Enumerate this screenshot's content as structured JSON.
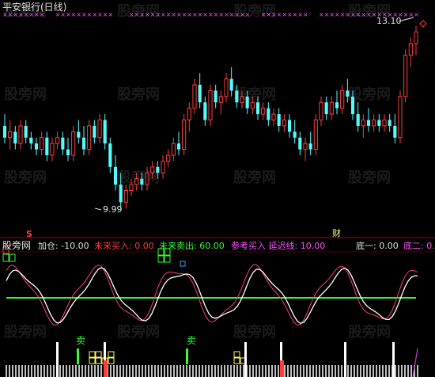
{
  "upper_panel": {
    "title": "平安银行(日线)",
    "high_label": "13.10",
    "low_label": "9.99",
    "marker_s": "S",
    "marker_cai": "财"
  },
  "indicator_header": {
    "name": "股旁网",
    "jiacang": "加仓: -10.00",
    "weilai_mai": "未来买入: 0.00",
    "weilai_maichu": "未来卖出: 60.00",
    "canjia_mairu": "参考买入 延迟线: 10.00",
    "di_yi": "底一: 0.00",
    "di_er": "底二: 0."
  },
  "signal_labels": {
    "sell1": "卖",
    "sell2": "卖",
    "buy_top_left": "卖",
    "buy_mid": "卖"
  },
  "watermark": "股旁网",
  "colors": {
    "up_candle": "#ff3c3c",
    "down_candle": "#54fcfc",
    "pink_x": "#ff50ff",
    "green_line": "#32ff32",
    "white_line": "#ffffff",
    "red_line": "#ff3c6e",
    "purple_line": "#c83cc8"
  },
  "chart_data": {
    "type": "candlestick",
    "price_range": [
      9.7,
      13.3
    ],
    "candles": [
      [
        11.4,
        11.6,
        11.1,
        11.2
      ],
      [
        11.2,
        11.5,
        11.0,
        11.3
      ],
      [
        11.3,
        11.4,
        11.0,
        11.1
      ],
      [
        11.1,
        11.5,
        11.0,
        11.4
      ],
      [
        11.4,
        11.5,
        11.1,
        11.2
      ],
      [
        11.2,
        11.3,
        11.0,
        11.1
      ],
      [
        11.1,
        11.2,
        10.9,
        11.0
      ],
      [
        11.0,
        11.3,
        10.9,
        11.2
      ],
      [
        11.2,
        11.3,
        10.8,
        10.9
      ],
      [
        10.9,
        11.2,
        10.8,
        11.1
      ],
      [
        11.1,
        11.3,
        11.0,
        11.2
      ],
      [
        11.2,
        11.3,
        10.9,
        11.0
      ],
      [
        11.0,
        11.2,
        10.8,
        10.9
      ],
      [
        10.9,
        11.4,
        10.8,
        11.3
      ],
      [
        11.3,
        11.5,
        11.1,
        11.2
      ],
      [
        11.2,
        11.4,
        10.9,
        11.0
      ],
      [
        11.0,
        11.5,
        10.9,
        11.4
      ],
      [
        11.4,
        11.5,
        11.1,
        11.2
      ],
      [
        11.2,
        11.6,
        11.1,
        11.5
      ],
      [
        11.5,
        11.6,
        11.0,
        11.1
      ],
      [
        11.1,
        11.2,
        10.6,
        10.7
      ],
      [
        10.7,
        10.9,
        10.3,
        10.4
      ],
      [
        10.4,
        10.6,
        10.0,
        10.1
      ],
      [
        10.1,
        10.4,
        9.99,
        10.3
      ],
      [
        10.3,
        10.5,
        10.2,
        10.4
      ],
      [
        10.4,
        10.6,
        10.3,
        10.5
      ],
      [
        10.5,
        10.6,
        10.3,
        10.4
      ],
      [
        10.4,
        10.7,
        10.3,
        10.6
      ],
      [
        10.6,
        10.8,
        10.5,
        10.7
      ],
      [
        10.7,
        10.8,
        10.5,
        10.6
      ],
      [
        10.6,
        10.9,
        10.5,
        10.8
      ],
      [
        10.8,
        11.0,
        10.7,
        10.9
      ],
      [
        10.9,
        11.2,
        10.8,
        11.1
      ],
      [
        11.1,
        11.3,
        10.9,
        11.0
      ],
      [
        11.0,
        11.6,
        10.9,
        11.5
      ],
      [
        11.5,
        11.8,
        11.3,
        11.7
      ],
      [
        11.7,
        12.2,
        11.6,
        12.1
      ],
      [
        12.1,
        12.3,
        11.7,
        11.8
      ],
      [
        11.8,
        11.9,
        11.4,
        11.5
      ],
      [
        11.5,
        12.1,
        11.4,
        12.0
      ],
      [
        12.0,
        12.1,
        11.7,
        11.8
      ],
      [
        11.8,
        12.0,
        11.6,
        11.9
      ],
      [
        11.9,
        12.3,
        11.8,
        12.2
      ],
      [
        12.2,
        12.4,
        11.9,
        12.0
      ],
      [
        12.0,
        12.1,
        11.7,
        11.8
      ],
      [
        11.8,
        12.0,
        11.7,
        11.9
      ],
      [
        11.9,
        12.0,
        11.6,
        11.7
      ],
      [
        11.7,
        11.9,
        11.6,
        11.8
      ],
      [
        11.8,
        11.9,
        11.5,
        11.6
      ],
      [
        11.6,
        11.8,
        11.5,
        11.7
      ],
      [
        11.7,
        11.8,
        11.4,
        11.5
      ],
      [
        11.5,
        11.7,
        11.4,
        11.6
      ],
      [
        11.6,
        11.7,
        11.3,
        11.4
      ],
      [
        11.4,
        11.6,
        11.3,
        11.5
      ],
      [
        11.5,
        11.6,
        11.2,
        11.3
      ],
      [
        11.3,
        11.5,
        11.1,
        11.2
      ],
      [
        11.2,
        11.3,
        10.9,
        11.0
      ],
      [
        11.0,
        11.2,
        10.8,
        11.1
      ],
      [
        11.1,
        11.3,
        10.9,
        11.0
      ],
      [
        11.0,
        11.6,
        10.9,
        11.5
      ],
      [
        11.5,
        11.9,
        11.4,
        11.8
      ],
      [
        11.8,
        11.9,
        11.5,
        11.6
      ],
      [
        11.6,
        11.9,
        11.5,
        11.8
      ],
      [
        11.8,
        12.0,
        11.6,
        11.7
      ],
      [
        11.7,
        12.1,
        11.6,
        12.0
      ],
      [
        12.0,
        12.2,
        11.8,
        11.9
      ],
      [
        11.9,
        12.0,
        11.5,
        11.6
      ],
      [
        11.6,
        11.8,
        11.3,
        11.4
      ],
      [
        11.4,
        11.6,
        11.2,
        11.5
      ],
      [
        11.5,
        11.7,
        11.3,
        11.4
      ],
      [
        11.4,
        11.6,
        11.3,
        11.5
      ],
      [
        11.5,
        11.6,
        11.3,
        11.4
      ],
      [
        11.4,
        11.6,
        11.3,
        11.5
      ],
      [
        11.5,
        11.6,
        11.3,
        11.4
      ],
      [
        11.4,
        11.6,
        11.1,
        11.2
      ],
      [
        11.2,
        12.0,
        11.1,
        11.9
      ],
      [
        11.9,
        12.7,
        11.8,
        12.6
      ],
      [
        12.6,
        12.9,
        12.4,
        12.8
      ],
      [
        12.8,
        13.1,
        12.6,
        13.0
      ]
    ],
    "x_markers": "row of magenta x markers along top"
  }
}
